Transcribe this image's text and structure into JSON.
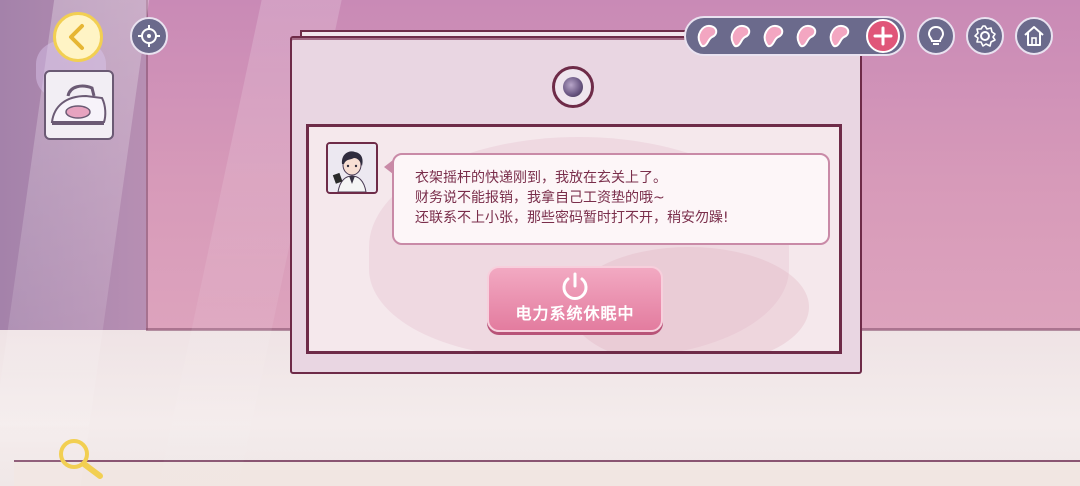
{
  "scene": {
    "name": "room-with-locked-box"
  },
  "message": {
    "lines": [
      "衣架摇杆的快递刚到，我放在玄关上了。",
      "财务说不能报销，我拿自己工资垫的哦~",
      "还联系不上小张，那些密码暂时打不开，稍安勿躁!"
    ]
  },
  "power_button": {
    "label": "电力系统休眠中"
  },
  "hint_counter": {
    "count": 5
  },
  "colors": {
    "wall": "#d79ab9",
    "accent": "#e37c9f",
    "dark": "#6b6a8c",
    "text": "#7a2e4b"
  }
}
